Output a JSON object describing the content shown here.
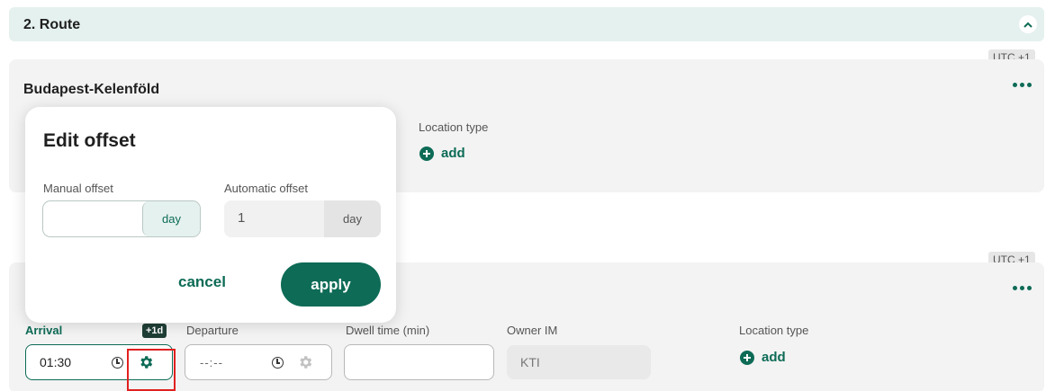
{
  "section": {
    "title": "2. Route"
  },
  "stops": [
    {
      "utc": "UTC +1",
      "name": "Budapest-Kelenföld",
      "location_type_label": "Location type",
      "add_label": "add"
    },
    {
      "utc": "UTC +1",
      "arrival_label": "Arrival",
      "offset_badge": "+1d",
      "arrival_value": "01:30",
      "departure_label": "Departure",
      "departure_value": "--:--",
      "dwell_label": "Dwell time (min)",
      "owner_label": "Owner IM",
      "owner_value": "KTI",
      "location_type_label": "Location type",
      "add_label": "add"
    }
  ],
  "popover": {
    "title": "Edit offset",
    "manual_label": "Manual offset",
    "manual_value": "",
    "manual_unit": "day",
    "auto_label": "Automatic offset",
    "auto_value": "1",
    "auto_unit": "day",
    "cancel_label": "cancel",
    "apply_label": "apply"
  },
  "colors": {
    "accent": "#0d6b56",
    "header_bg": "#e5f1ef",
    "highlight": "#e02020"
  }
}
